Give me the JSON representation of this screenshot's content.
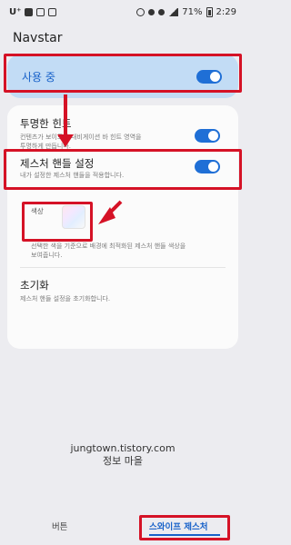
{
  "status_bar": {
    "carrier": "U⁺",
    "battery": "71%",
    "time": "2:29"
  },
  "app": {
    "title": "Navstar"
  },
  "settings": {
    "in_use": {
      "label": "사용 중",
      "enabled": true
    },
    "transparent_hint": {
      "title": "투명한 힌트",
      "description_line1": "컨텐츠가 보이도록 내비게이션 바 힌트 영역을",
      "description_line2": "투명하게 만듭니다.",
      "enabled": true
    },
    "gesture_handle": {
      "title": "제스처 핸들 설정",
      "description": "내가 설정한 제스처 핸들을 적용합니다.",
      "enabled": true
    },
    "color": {
      "label": "색상",
      "description_line1": "선택한 색을 기준으로 배경에 최적화된 제스처 핸들 색상을",
      "description_line2": "보여줍니다."
    },
    "reset": {
      "title": "초기화",
      "description": "제스처 핸들 설정을 초기화합니다."
    }
  },
  "watermark": {
    "line1": "jungtown.tistory.com",
    "line2": "정보 마을"
  },
  "bottom_nav": {
    "items": [
      {
        "label": "버튼",
        "active": false
      },
      {
        "label": "스와이프 제스처",
        "active": true
      }
    ]
  },
  "colors": {
    "accent": "#1f6fd6",
    "highlight_background": "#c2dcf5",
    "annotation_red": "#d51226"
  }
}
